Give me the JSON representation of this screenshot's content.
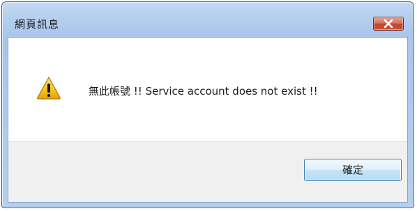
{
  "dialog": {
    "title": "網頁訊息",
    "message": "無此帳號 !! Service account does not exist !!",
    "ok_label": "確定",
    "icon": "warning-icon",
    "close_icon": "close-icon"
  },
  "colors": {
    "title_bar": "#b7d0ee",
    "close_button": "#c9513a",
    "button_area": "#f0f0f0",
    "ok_button_border": "#3c7fb1",
    "warning_yellow": "#f5c419"
  }
}
